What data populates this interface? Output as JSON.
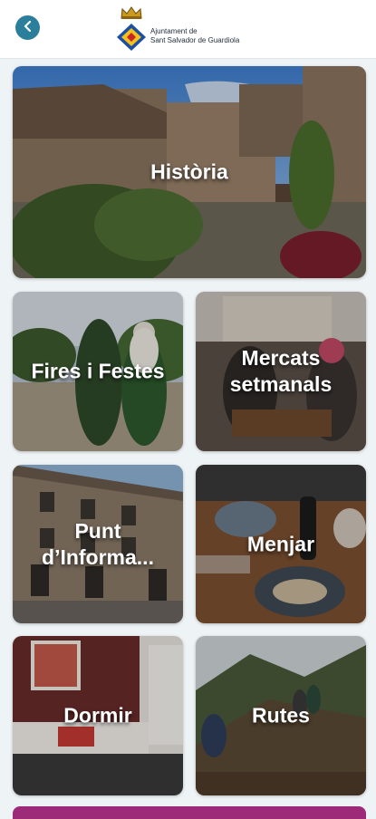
{
  "header": {
    "back_icon": "chevron-left-icon",
    "org_line1": "Ajuntament de",
    "org_line2": "Sant Salvador de Guardiola",
    "crown_icon": "crown-icon",
    "shield_icon": "coat-of-arms-icon"
  },
  "tiles": [
    {
      "label": "Història"
    },
    {
      "label": "Fires i Festes"
    },
    {
      "label": "Mercats setmanals"
    },
    {
      "label": "Punt d’Informa..."
    },
    {
      "label": "Menjar"
    },
    {
      "label": "Dormir"
    },
    {
      "label": "Rutes"
    }
  ],
  "colors": {
    "accent": "#2b7f9a",
    "bottom_bar": "#9d2a78",
    "background": "#eef3f5"
  }
}
